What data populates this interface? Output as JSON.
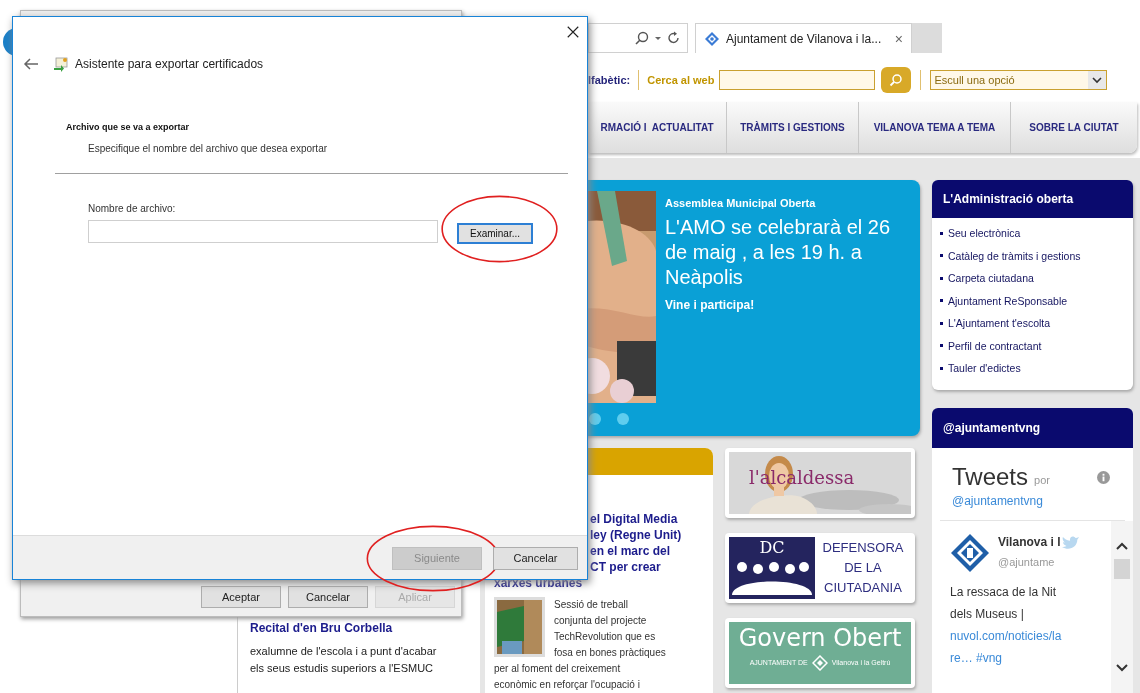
{
  "browser": {
    "tab": {
      "title": "Ajuntament de Vilanova i la...",
      "close": "×"
    },
    "toolbar": {
      "index_label": "lfabètic:",
      "search_label": "Cerca al web",
      "select_value": "Escull una opció"
    },
    "nav": [
      "RMACIÓ I  ACTUALITAT",
      "TRÀMITS I GESTIONS",
      "VILANOVA TEMA A TEMA",
      "SOBRE LA CIUTAT"
    ]
  },
  "slider": {
    "kicker": "Assemblea Municipal Oberta",
    "headline": "L'AMO se celebrarà el 26 de maig , a les 19 h. a Neàpolis",
    "subline": "Vine i participa!"
  },
  "admin_panel": {
    "title": "L'Administració oberta",
    "links": [
      "Seu electrònica",
      "Catàleg de tràmits i gestions",
      "Carpeta ciutadana",
      "Ajuntament ReSponsable",
      "L'Ajuntament t'escolta",
      "Perfil de contractant",
      "Tauler d'edictes"
    ]
  },
  "twitter": {
    "title": "@ajuntamentvng",
    "heading": "Tweets",
    "by": "por",
    "handle_link": "@ajuntamentvng",
    "tweet": {
      "name": "Vilanova i l",
      "handle": "@ajuntame",
      "lines": [
        {
          "text": "La ressaca de la Nit",
          "kind": "plain"
        },
        {
          "text": "dels Museus |",
          "kind": "plain"
        },
        {
          "text": "nuvol.com/noticies/la",
          "kind": "link"
        },
        {
          "text": "re… #vng",
          "kind": "link"
        }
      ]
    }
  },
  "news_card": {
    "headline_lines": [
      "el Digital Media",
      "ley (Regne Unit)",
      "en el marc del",
      "CT per crear",
      "xarxes urbanes"
    ],
    "lines_beside_image": [
      "Sessió de treball",
      "conjunta del projecte",
      "TechRevolution que es",
      "fosa en bones pràctiques"
    ],
    "lines_below": [
      "per al foment del creixement",
      "econòmic en reforçar l'ocupació i"
    ]
  },
  "banners": [
    {
      "kind": "mayor",
      "text": "l'alcaldessa"
    },
    {
      "kind": "ombudsman",
      "logo": "DC",
      "lines": [
        "DEFENSORA",
        "DE LA",
        "CIUTADANIA"
      ]
    },
    {
      "kind": "open_government",
      "title": "Govern Obert",
      "left": "AJUNTAMENT DE",
      "right": "Vilanova i la Geltrú"
    }
  ],
  "left_news": {
    "title": "Recital d'en Bru Corbella",
    "body_lines": [
      "exalumne de l'escola i a punt d'acabar",
      "els seus estudis superiors a l'ESMUC"
    ]
  },
  "properties_dialog": {
    "buttons": [
      {
        "label": "Aceptar",
        "disabled": false
      },
      {
        "label": "Cancelar",
        "disabled": false
      },
      {
        "label": "Aplicar",
        "disabled": true
      }
    ]
  },
  "wizard": {
    "title": "Asistente para exportar certificados",
    "heading": "Archivo que se va a exportar",
    "description": "Especifique el nombre del archivo que desea exportar",
    "field_label": "Nombre de archivo:",
    "browse_button": {
      "label": "Examinar...",
      "highlighted": true
    },
    "buttons": [
      {
        "label": "Siguiente",
        "disabled": true,
        "highlighted": true
      },
      {
        "label": "Cancelar",
        "disabled": false,
        "highlighted": false
      }
    ]
  }
}
